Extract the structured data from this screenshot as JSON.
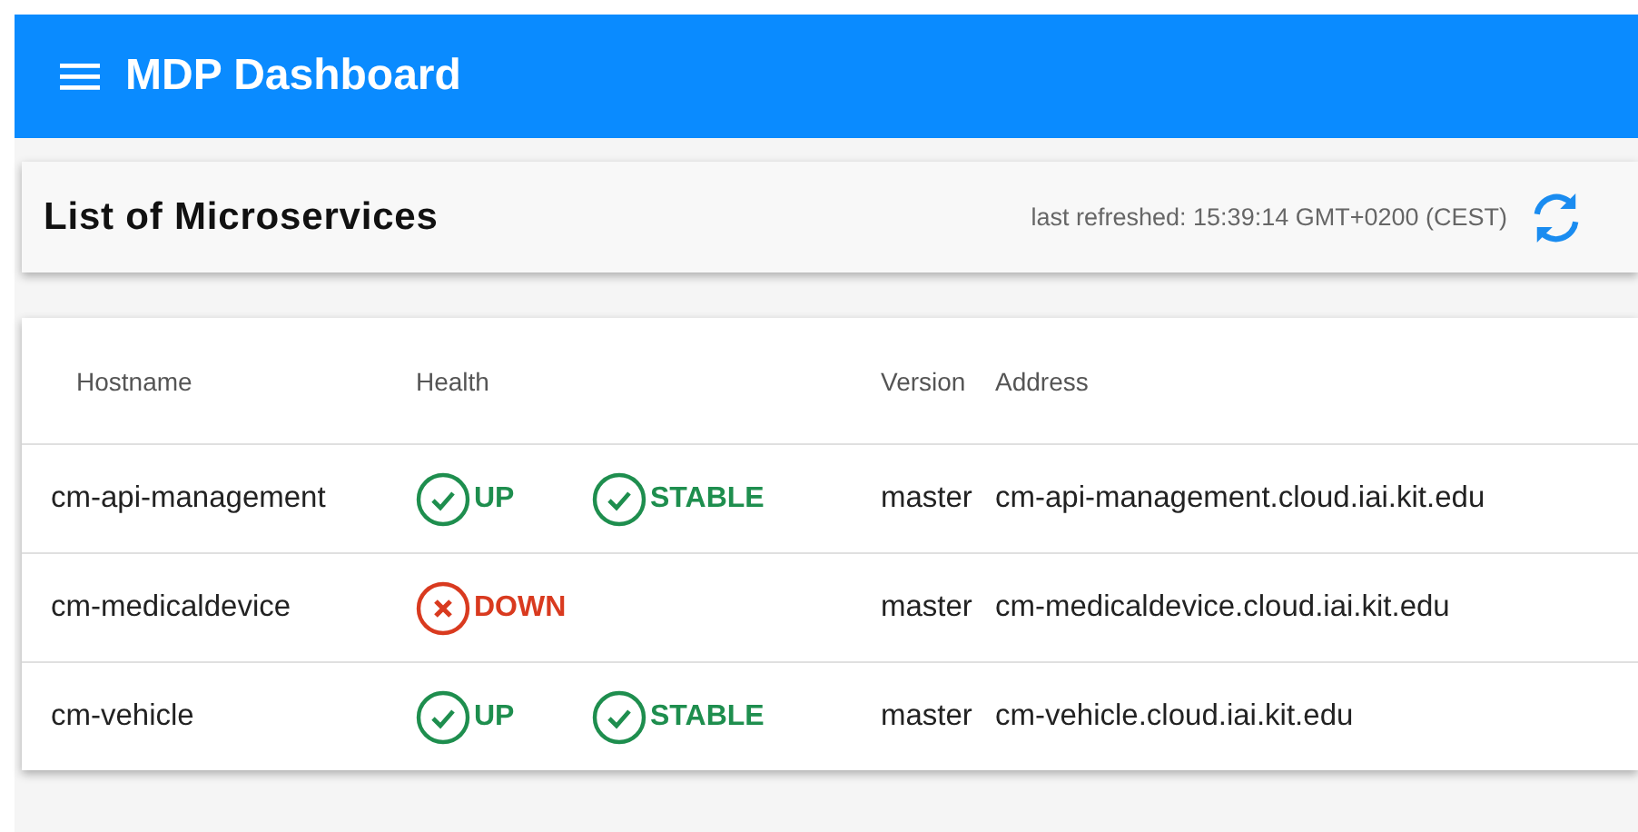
{
  "app_bar": {
    "title": "MDP Dashboard"
  },
  "panel": {
    "title": "List of Microservices",
    "last_refreshed": "last refreshed: 15:39:14 GMT+0200 (CEST)"
  },
  "table": {
    "columns": [
      "Hostname",
      "Health",
      "Version",
      "Address"
    ],
    "rows": [
      {
        "hostname": "cm-api-management",
        "health": [
          {
            "label": "UP",
            "kind": "ok"
          },
          {
            "label": "STABLE",
            "kind": "ok"
          }
        ],
        "version": "master",
        "address": "cm-api-management.cloud.iai.kit.edu"
      },
      {
        "hostname": "cm-medicaldevice",
        "health": [
          {
            "label": "DOWN",
            "kind": "error"
          }
        ],
        "version": "master",
        "address": "cm-medicaldevice.cloud.iai.kit.edu"
      },
      {
        "hostname": "cm-vehicle",
        "health": [
          {
            "label": "UP",
            "kind": "ok"
          },
          {
            "label": "STABLE",
            "kind": "ok"
          }
        ],
        "version": "master",
        "address": "cm-vehicle.cloud.iai.kit.edu"
      }
    ]
  }
}
